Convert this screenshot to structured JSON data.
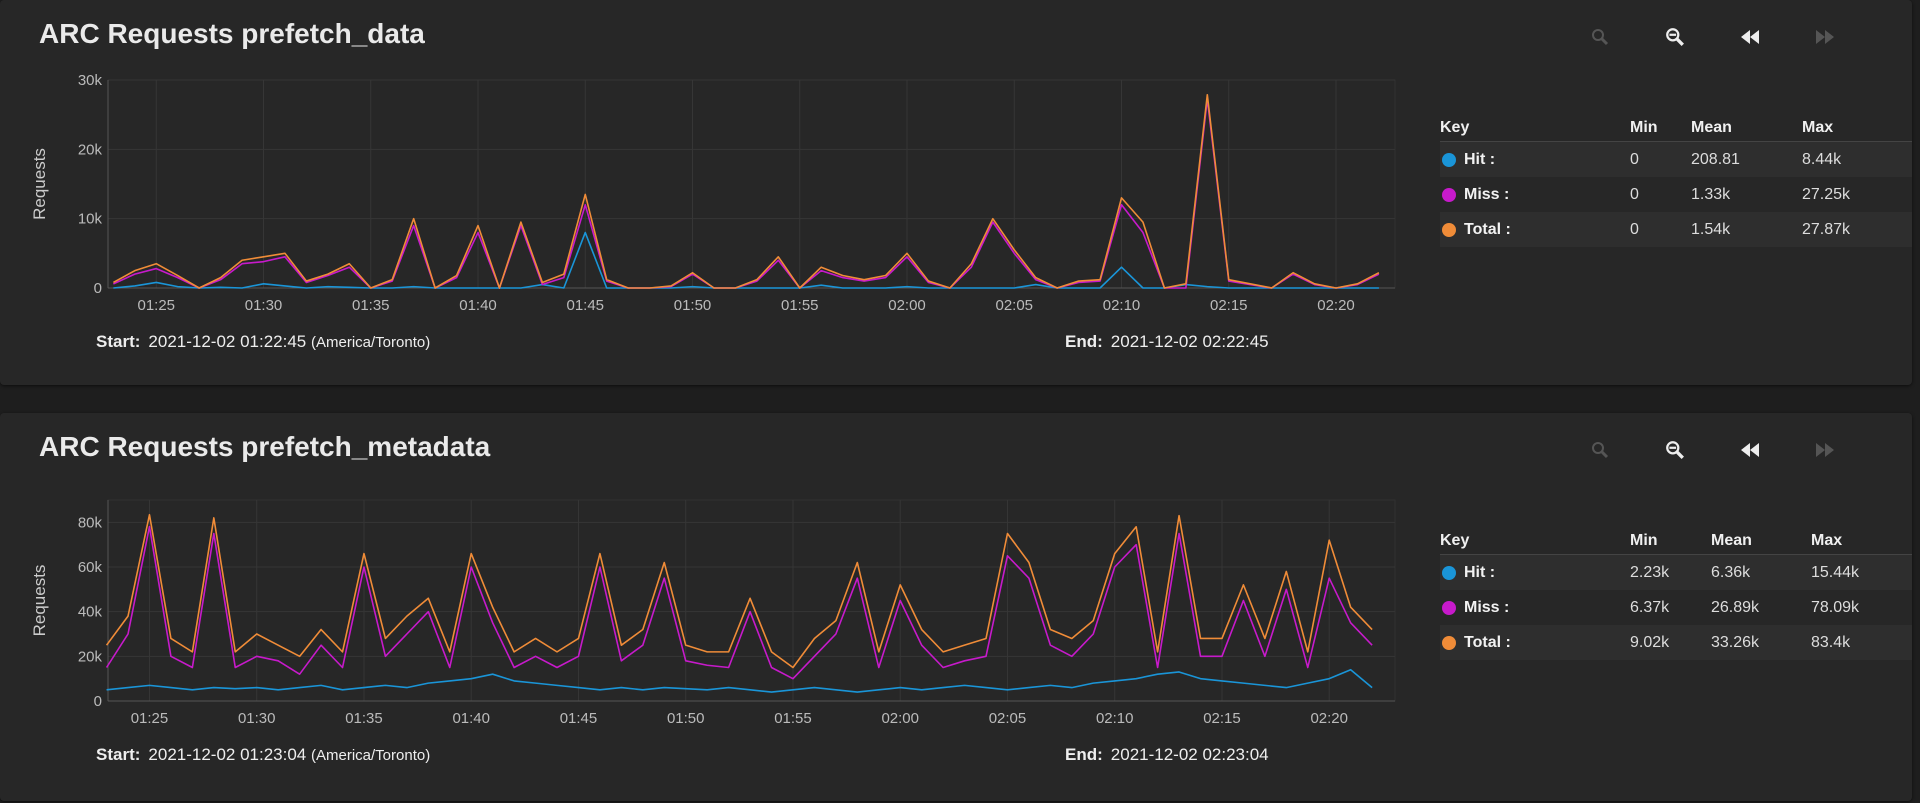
{
  "panels": [
    {
      "title": "ARC Requests prefetch_data",
      "start_label": "Start:",
      "start_value": "2021-12-02 01:22:45",
      "timezone": "(America/Toronto)",
      "end_label": "End:",
      "end_value": "2021-12-02 02:22:45",
      "legend": {
        "headers": [
          "Key",
          "Min",
          "Mean",
          "Max"
        ],
        "rows": [
          {
            "name": "Hit :",
            "color": "#1a95d8",
            "min": "0",
            "mean": "208.81",
            "max": "8.44k"
          },
          {
            "name": "Miss :",
            "color": "#c71acb",
            "min": "0",
            "mean": "1.33k",
            "max": "27.25k"
          },
          {
            "name": "Total :",
            "color": "#f08c38",
            "min": "0",
            "mean": "1.54k",
            "max": "27.87k"
          }
        ]
      }
    },
    {
      "title": "ARC Requests prefetch_metadata",
      "start_label": "Start:",
      "start_value": "2021-12-02 01:23:04",
      "timezone": "(America/Toronto)",
      "end_label": "End:",
      "end_value": "2021-12-02 02:23:04",
      "legend": {
        "headers": [
          "Key",
          "Min",
          "Mean",
          "Max"
        ],
        "rows": [
          {
            "name": "Hit :",
            "color": "#1a95d8",
            "min": "2.23k",
            "mean": "6.36k",
            "max": "15.44k"
          },
          {
            "name": "Miss :",
            "color": "#c71acb",
            "min": "6.37k",
            "mean": "26.89k",
            "max": "78.09k"
          },
          {
            "name": "Total :",
            "color": "#f08c38",
            "min": "9.02k",
            "mean": "33.26k",
            "max": "83.4k"
          }
        ]
      }
    }
  ],
  "toolbar_icons": [
    "zoom-in-icon",
    "zoom-out-icon",
    "rewind-icon",
    "fast-forward-icon"
  ],
  "chart_data": [
    {
      "type": "line",
      "ylabel": "Requests",
      "ylim": [
        0,
        30000
      ],
      "yticks": [
        0,
        10000,
        20000,
        30000
      ],
      "ytick_labels": [
        "0",
        "10k",
        "20k",
        "30k"
      ],
      "xlim": [
        "01:22:45",
        "02:22:45"
      ],
      "xtick_labels": [
        "01:25",
        "01:30",
        "01:35",
        "01:40",
        "01:45",
        "01:50",
        "01:55",
        "02:00",
        "02:05",
        "02:10",
        "02:15",
        "02:20"
      ],
      "grid": true,
      "x": [
        "01:23",
        "01:24",
        "01:25",
        "01:26",
        "01:27",
        "01:28",
        "01:29",
        "01:30",
        "01:31",
        "01:32",
        "01:33",
        "01:34",
        "01:35",
        "01:36",
        "01:37",
        "01:38",
        "01:39",
        "01:40",
        "01:41",
        "01:42",
        "01:43",
        "01:44",
        "01:45",
        "01:46",
        "01:47",
        "01:48",
        "01:49",
        "01:50",
        "01:51",
        "01:52",
        "01:53",
        "01:54",
        "01:55",
        "01:56",
        "01:57",
        "01:58",
        "01:59",
        "02:00",
        "02:01",
        "02:02",
        "02:03",
        "02:04",
        "02:05",
        "02:06",
        "02:07",
        "02:08",
        "02:09",
        "02:10",
        "02:11",
        "02:12",
        "02:13",
        "02:14",
        "02:15",
        "02:16",
        "02:17",
        "02:18",
        "02:19",
        "02:20",
        "02:21",
        "02:22"
      ],
      "series": [
        {
          "name": "Hit",
          "color": "#1a95d8",
          "values": [
            0,
            300,
            800,
            200,
            0,
            100,
            0,
            600,
            300,
            0,
            200,
            100,
            0,
            0,
            200,
            0,
            0,
            0,
            0,
            0,
            500,
            0,
            8000,
            0,
            0,
            0,
            0,
            200,
            0,
            0,
            0,
            0,
            0,
            400,
            0,
            0,
            0,
            200,
            0,
            0,
            0,
            0,
            0,
            500,
            0,
            0,
            0,
            3000,
            0,
            0,
            500,
            200,
            0,
            0,
            0,
            0,
            0,
            0,
            0,
            0
          ]
        },
        {
          "name": "Miss",
          "color": "#c71acb",
          "values": [
            600,
            2000,
            2800,
            1500,
            0,
            1200,
            3500,
            3800,
            4500,
            800,
            1800,
            3000,
            0,
            1000,
            9000,
            0,
            1500,
            8000,
            0,
            9000,
            500,
            1500,
            12000,
            1000,
            0,
            0,
            200,
            2000,
            0,
            0,
            1000,
            4000,
            0,
            2500,
            1500,
            1000,
            1500,
            4500,
            800,
            0,
            3000,
            9500,
            5000,
            1200,
            0,
            800,
            1000,
            12000,
            8000,
            0,
            0,
            27250,
            1000,
            500,
            0,
            2000,
            500,
            0,
            500,
            2000
          ]
        },
        {
          "name": "Total",
          "color": "#f08c38",
          "values": [
            800,
            2500,
            3500,
            1800,
            0,
            1500,
            4000,
            4500,
            5000,
            1000,
            2000,
            3500,
            0,
            1200,
            10000,
            0,
            1800,
            9000,
            0,
            9500,
            800,
            2000,
            13500,
            1200,
            0,
            0,
            300,
            2200,
            0,
            0,
            1200,
            4500,
            0,
            3000,
            1800,
            1200,
            1800,
            5000,
            1000,
            0,
            3500,
            10000,
            5500,
            1500,
            0,
            1000,
            1200,
            13000,
            9500,
            0,
            600,
            27870,
            1200,
            600,
            0,
            2200,
            600,
            0,
            600,
            2200
          ]
        }
      ]
    },
    {
      "type": "line",
      "ylabel": "Requests",
      "ylim": [
        0,
        90000
      ],
      "yticks": [
        0,
        20000,
        40000,
        60000,
        80000
      ],
      "ytick_labels": [
        "0",
        "20k",
        "40k",
        "60k",
        "80k"
      ],
      "xlim": [
        "01:23:04",
        "02:23:04"
      ],
      "xtick_labels": [
        "01:25",
        "01:30",
        "01:35",
        "01:40",
        "01:45",
        "01:50",
        "01:55",
        "02:00",
        "02:05",
        "02:10",
        "02:15",
        "02:20"
      ],
      "grid": true,
      "x": [
        "01:23",
        "01:24",
        "01:25",
        "01:26",
        "01:27",
        "01:28",
        "01:29",
        "01:30",
        "01:31",
        "01:32",
        "01:33",
        "01:34",
        "01:35",
        "01:36",
        "01:37",
        "01:38",
        "01:39",
        "01:40",
        "01:41",
        "01:42",
        "01:43",
        "01:44",
        "01:45",
        "01:46",
        "01:47",
        "01:48",
        "01:49",
        "01:50",
        "01:51",
        "01:52",
        "01:53",
        "01:54",
        "01:55",
        "01:56",
        "01:57",
        "01:58",
        "01:59",
        "02:00",
        "02:01",
        "02:02",
        "02:03",
        "02:04",
        "02:05",
        "02:06",
        "02:07",
        "02:08",
        "02:09",
        "02:10",
        "02:11",
        "02:12",
        "02:13",
        "02:14",
        "02:15",
        "02:16",
        "02:17",
        "02:18",
        "02:19",
        "02:20",
        "02:21",
        "02:22"
      ],
      "series": [
        {
          "name": "Hit",
          "color": "#1a95d8",
          "values": [
            5000,
            6000,
            7000,
            6000,
            5000,
            6000,
            5500,
            6000,
            5000,
            6000,
            7000,
            5000,
            6000,
            7000,
            6000,
            8000,
            9000,
            10000,
            12000,
            9000,
            8000,
            7000,
            6000,
            5000,
            6000,
            5000,
            6000,
            5500,
            5000,
            6000,
            5000,
            4000,
            5000,
            6000,
            5000,
            4000,
            5000,
            6000,
            5000,
            6000,
            7000,
            6000,
            5000,
            6000,
            7000,
            6000,
            8000,
            9000,
            10000,
            12000,
            13000,
            10000,
            9000,
            8000,
            7000,
            6000,
            8000,
            10000,
            14000,
            6000
          ]
        },
        {
          "name": "Miss",
          "color": "#c71acb",
          "values": [
            15000,
            30000,
            78090,
            20000,
            15000,
            75000,
            15000,
            20000,
            18000,
            12000,
            25000,
            15000,
            60000,
            20000,
            30000,
            40000,
            15000,
            60000,
            35000,
            15000,
            20000,
            15000,
            20000,
            60000,
            18000,
            25000,
            55000,
            18000,
            16000,
            15000,
            40000,
            15000,
            10000,
            20000,
            30000,
            55000,
            15000,
            45000,
            25000,
            15000,
            18000,
            20000,
            65000,
            55000,
            25000,
            20000,
            30000,
            60000,
            70000,
            15000,
            75000,
            20000,
            20000,
            45000,
            20000,
            50000,
            15000,
            55000,
            35000,
            25000
          ]
        },
        {
          "name": "Total",
          "color": "#f08c38",
          "values": [
            25000,
            38000,
            83400,
            28000,
            22000,
            82000,
            22000,
            30000,
            25000,
            20000,
            32000,
            22000,
            66000,
            28000,
            38000,
            46000,
            22000,
            66000,
            42000,
            22000,
            28000,
            22000,
            28000,
            66000,
            25000,
            32000,
            62000,
            25000,
            22000,
            22000,
            46000,
            22000,
            15000,
            28000,
            36000,
            62000,
            22000,
            52000,
            32000,
            22000,
            25000,
            28000,
            75000,
            62000,
            32000,
            28000,
            36000,
            66000,
            78000,
            22000,
            83000,
            28000,
            28000,
            52000,
            28000,
            58000,
            22000,
            72000,
            42000,
            32000
          ]
        }
      ]
    }
  ]
}
